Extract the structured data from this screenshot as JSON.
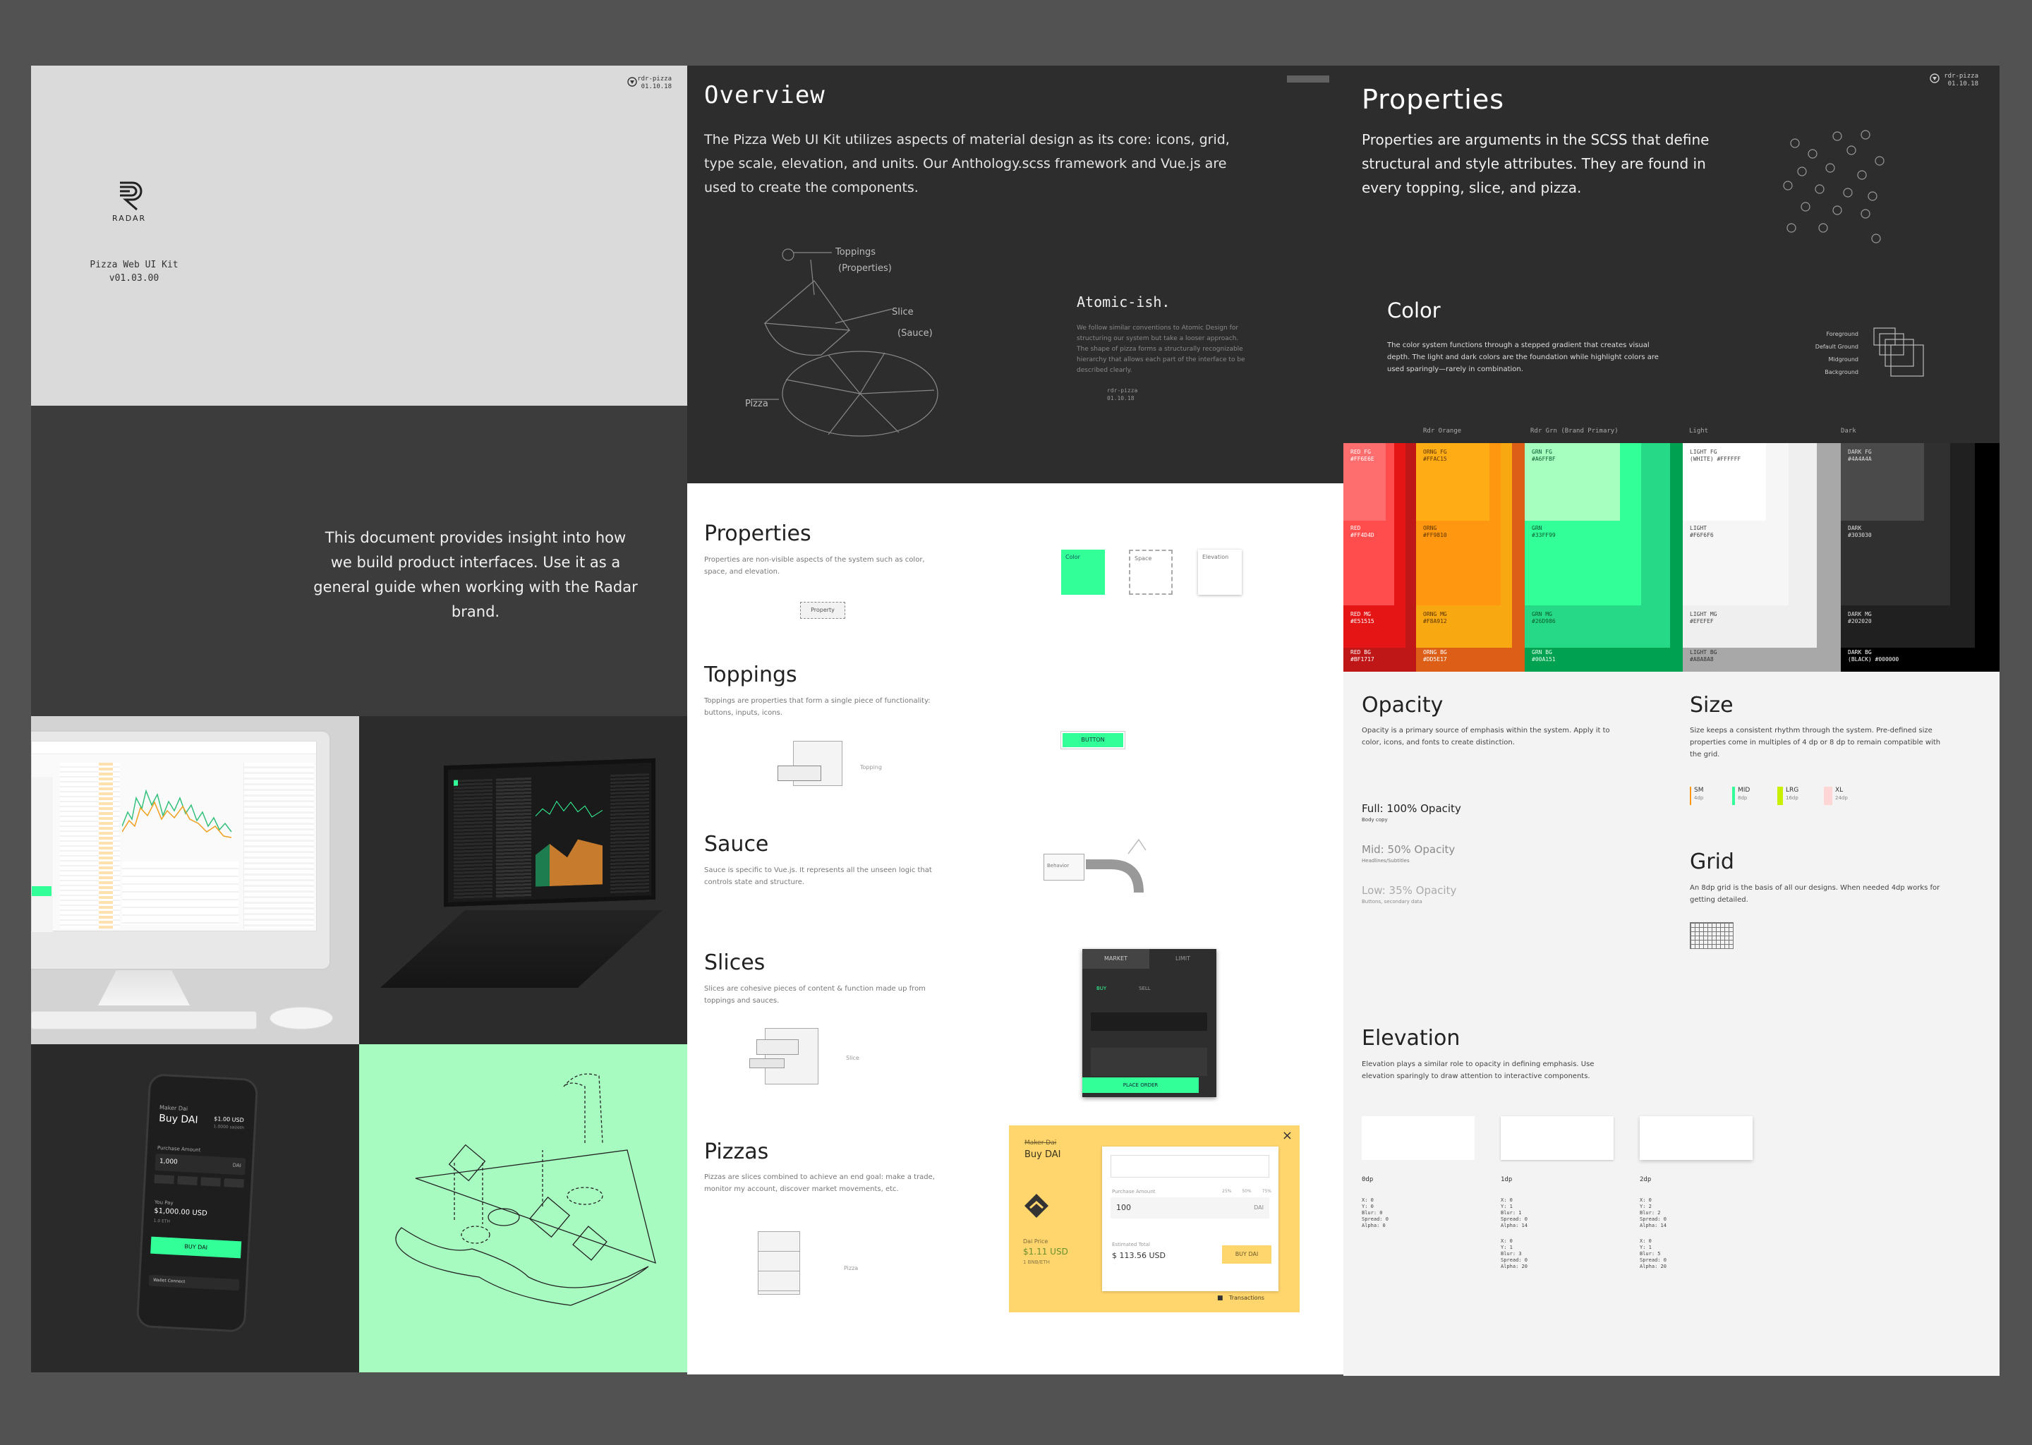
{
  "cover": {
    "corner_label": "rdr-pizza",
    "corner_date": "01.10.18",
    "logo_text": "RADAR",
    "kit_title": "Pizza Web UI Kit",
    "kit_version": "v01.03.00"
  },
  "intro": {
    "text": "This document provides insight into how we build product interfaces. Use it as a general guide when working with the Radar brand."
  },
  "mockups": {
    "phone_wallet": "Maker Dai",
    "phone_title": "Buy DAI",
    "phone_price": "$1.00 USD",
    "phone_price_sub": "1.0000 sai/eth",
    "phone_amount_label": "Purchase Amount",
    "phone_amount": "1,000",
    "phone_amount_unit": "DAI",
    "phone_total_label": "You Pay",
    "phone_total": "$1,000.00 USD",
    "phone_total_sub": "1.0 ETH",
    "phone_button": "BUY DAI",
    "phone_footer": "Wallet Connect"
  },
  "overview": {
    "title": "Overview",
    "body": "The Pizza Web UI Kit utilizes aspects of material design as its core: icons, grid, type scale, elevation, and units. Our Anthology.scss framework and Vue.js are used to create the components.",
    "diagram_labels": [
      "Toppings",
      "(Properties)",
      "Slice",
      "(Sauce)",
      "Pizza"
    ],
    "atomic_title": "Atomic-ish.",
    "atomic_body": "We follow similar conventions to Atomic Design for structuring our system but take a looser approach. The shape of pizza forms a structurally recognizable hierarchy that allows each part of the interface to be described clearly.",
    "footer_label": "rdr-pizza",
    "footer_date": "01.10.18"
  },
  "sections": [
    {
      "title": "Properties",
      "body": "Properties are non-visible aspects of the system such as color, space, and elevation.",
      "tag": "Property"
    },
    {
      "title": "Toppings",
      "body": "Toppings are properties that form a single piece of functionality: buttons, inputs, icons.",
      "tag": "Topping"
    },
    {
      "title": "Sauce",
      "body": "Sauce is specific to Vue.js. It represents all the unseen logic that controls state and structure.",
      "tag": "Behavior"
    },
    {
      "title": "Slices",
      "body": "Slices are cohesive pieces of content & function made up from toppings and sauces.",
      "tag": "Slice"
    },
    {
      "title": "Pizzas",
      "body": "Pizzas are slices combined to achieve an end goal: make a trade, monitor my account, discover market movements, etc.",
      "tag": "Pizza"
    }
  ],
  "property_boxes": [
    "Color",
    "Space",
    "Elevation"
  ],
  "topping_button": "BUTTON",
  "slice_widget": {
    "tabs": [
      "MARKET",
      "LIMIT"
    ],
    "subtabs": [
      "BUY",
      "SELL"
    ],
    "button": "PLACE ORDER"
  },
  "pizza_card": {
    "wallet": "Maker Dai",
    "title": "Buy DAI",
    "field_label": "Purchase Amount",
    "amount": "100",
    "unit": "DAI",
    "price_label": "Dai Price",
    "price": "$1.11 USD",
    "price_sub": "1 BNB/ETH",
    "total_label": "Estimated Total",
    "total": "$ 113.56 USD",
    "buy": "BUY DAI",
    "footer": "Transactions",
    "options": [
      "25%",
      "50%",
      "75%"
    ]
  },
  "properties": {
    "title": "Properties",
    "body": "Properties are arguments in the SCSS that define structural and style attributes. They are found in every topping, slice, and pizza.",
    "corner_label": "rdr-pizza",
    "corner_date": "01.10.18"
  },
  "color": {
    "title": "Color",
    "body": "The color system functions through a stepped gradient that creates visual depth. The light and dark colors are the foundation while highlight colors are used sparingly—rarely in combination.",
    "layers": [
      "Foreground",
      "Default Ground",
      "Midground",
      "Background"
    ],
    "palette_headers": [
      "Rdr Orange",
      "Rdr Grn (Brand Primary)",
      "Light",
      "Dark"
    ],
    "swatches": [
      {
        "name": "RED FG",
        "hex": "#FF6E6E"
      },
      {
        "name": "RED",
        "hex": "#FF4D4D"
      },
      {
        "name": "RED MG",
        "hex": "#E51515"
      },
      {
        "name": "RED BG",
        "hex": "#BF1717"
      },
      {
        "name": "ORNG FG",
        "hex": "#FFAC15"
      },
      {
        "name": "ORNG",
        "hex": "#FF9810"
      },
      {
        "name": "ORNG MG",
        "hex": "#F8A912"
      },
      {
        "name": "ORNG BG",
        "hex": "#DD5E17"
      },
      {
        "name": "GRN FG",
        "hex": "#A6FFBF"
      },
      {
        "name": "GRN",
        "hex": "#33FF99"
      },
      {
        "name": "GRN MG",
        "hex": "#26D986"
      },
      {
        "name": "GRN BG",
        "hex": "#00A151"
      },
      {
        "name": "LIGHT FG",
        "hex": "(WHITE) #FFFFFF"
      },
      {
        "name": "LIGHT",
        "hex": "#F6F6F6"
      },
      {
        "name": "LIGHT MG",
        "hex": "#EFEFEF"
      },
      {
        "name": "LIGHT BG",
        "hex": "#A8A8A8"
      },
      {
        "name": "DARK FG",
        "hex": "#4A4A4A"
      },
      {
        "name": "DARK",
        "hex": "#303030"
      },
      {
        "name": "DARK MG",
        "hex": "#202020"
      },
      {
        "name": "DARK BG",
        "hex": "(BLACK) #000000"
      }
    ]
  },
  "opacity": {
    "title": "Opacity",
    "body": "Opacity is a primary source of emphasis within the system. Apply it to color, icons, and fonts to create distinction.",
    "levels": [
      {
        "label": "Full: 100% Opacity",
        "sub": "Body copy"
      },
      {
        "label": "Mid: 50% Opacity",
        "sub": "Headlines/Subtitles"
      },
      {
        "label": "Low: 35% Opacity",
        "sub": "Buttons, secondary data"
      }
    ]
  },
  "size": {
    "title": "Size",
    "body": "Size keeps a consistent rhythm through the system. Pre-defined size properties come in multiples of 4 dp or 8 dp to remain compatible with the grid.",
    "items": [
      {
        "label": "SM",
        "value": "4dp",
        "color": "#FF9810"
      },
      {
        "label": "MID",
        "value": "8dp",
        "color": "#33FF99"
      },
      {
        "label": "LRG",
        "value": "16dp",
        "color": "#C8F000"
      },
      {
        "label": "XL",
        "value": "24dp",
        "color": "#FFB0B0"
      }
    ]
  },
  "grid": {
    "title": "Grid",
    "body": "An 8dp grid is the basis of all our designs. When needed 4dp works for getting detailed."
  },
  "elevation": {
    "title": "Elevation",
    "body": "Elevation plays a similar role to opacity in defining emphasis. Use elevation sparingly to draw attention to interactive components.",
    "levels": [
      {
        "name": "0dp",
        "a": "X: 0\nY: 0\nBlur: 0\nSpread: 0\nAlpha: 0",
        "b": ""
      },
      {
        "name": "1dp",
        "a": "X: 0\nY: 1\nBlur: 1\nSpread: 0\nAlpha: 14",
        "b": "X: 0\nY: 1\nBlur: 3\nSpread: 0\nAlpha: 20"
      },
      {
        "name": "2dp",
        "a": "X: 0\nY: 2\nBlur: 2\nSpread: 0\nAlpha: 14",
        "b": "X: 0\nY: 1\nBlur: 5\nSpread: 0\nAlpha: 20"
      }
    ]
  }
}
